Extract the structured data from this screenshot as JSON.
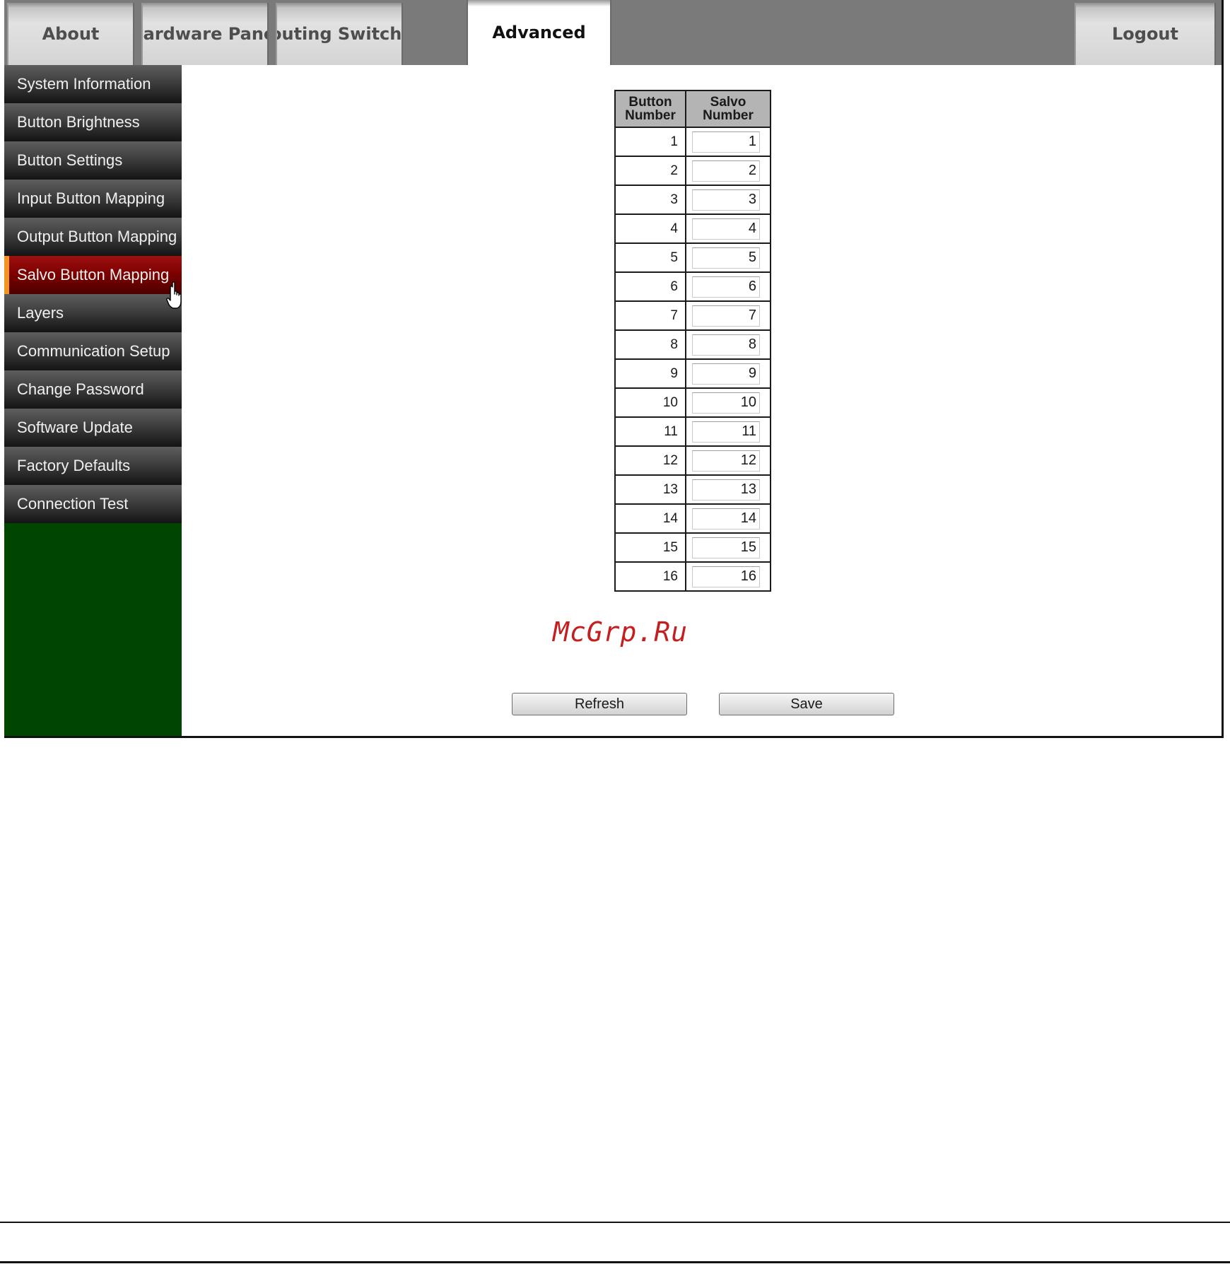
{
  "tabs": {
    "about": "About",
    "hardware_panel": "Hardware Panel",
    "routing_switcher": "Routing Switcher",
    "advanced": "Advanced",
    "logout": "Logout"
  },
  "sidebar": {
    "items": [
      {
        "label": "System Information"
      },
      {
        "label": "Button Brightness"
      },
      {
        "label": "Button Settings"
      },
      {
        "label": "Input Button Mapping"
      },
      {
        "label": "Output Button Mapping"
      },
      {
        "label": "Salvo Button Mapping"
      },
      {
        "label": "Layers"
      },
      {
        "label": "Communication Setup"
      },
      {
        "label": "Change Password"
      },
      {
        "label": "Software Update"
      },
      {
        "label": "Factory Defaults"
      },
      {
        "label": "Connection Test"
      }
    ],
    "active_index": 5
  },
  "table": {
    "header_button_line1": "Button",
    "header_button_line2": "Number",
    "header_salvo_line1": "Salvo",
    "header_salvo_line2": "Number",
    "rows": [
      {
        "button": "1",
        "salvo": "1"
      },
      {
        "button": "2",
        "salvo": "2"
      },
      {
        "button": "3",
        "salvo": "3"
      },
      {
        "button": "4",
        "salvo": "4"
      },
      {
        "button": "5",
        "salvo": "5"
      },
      {
        "button": "6",
        "salvo": "6"
      },
      {
        "button": "7",
        "salvo": "7"
      },
      {
        "button": "8",
        "salvo": "8"
      },
      {
        "button": "9",
        "salvo": "9"
      },
      {
        "button": "10",
        "salvo": "10"
      },
      {
        "button": "11",
        "salvo": "11"
      },
      {
        "button": "12",
        "salvo": "12"
      },
      {
        "button": "13",
        "salvo": "13"
      },
      {
        "button": "14",
        "salvo": "14"
      },
      {
        "button": "15",
        "salvo": "15"
      },
      {
        "button": "16",
        "salvo": "16"
      }
    ]
  },
  "watermark": "McGrp.Ru",
  "actions": {
    "refresh_label": "Refresh",
    "save_label": "Save"
  },
  "colors": {
    "sidebar_background": "#004600",
    "active_sidebar_item": "#7a0000",
    "active_sidebar_accent": "#f29422",
    "topbar_background": "#7a7a7a",
    "watermark": "#c41e1e"
  },
  "icons": {
    "cursor": "hand-pointer-icon"
  }
}
